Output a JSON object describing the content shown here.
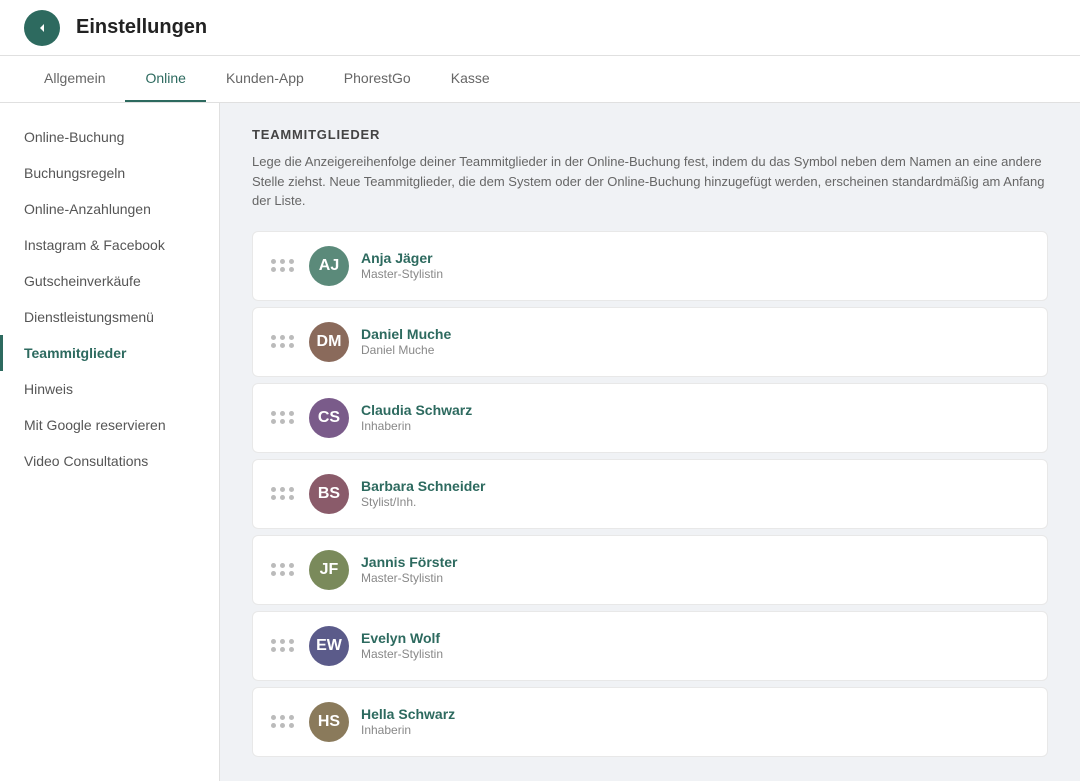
{
  "header": {
    "title": "Einstellungen",
    "back_label": "Back"
  },
  "tabs": [
    {
      "id": "allgemein",
      "label": "Allgemein",
      "active": false
    },
    {
      "id": "online",
      "label": "Online",
      "active": true
    },
    {
      "id": "kunden-app",
      "label": "Kunden-App",
      "active": false
    },
    {
      "id": "phorestgo",
      "label": "PhorestGo",
      "active": false
    },
    {
      "id": "kasse",
      "label": "Kasse",
      "active": false
    }
  ],
  "sidebar": {
    "items": [
      {
        "id": "online-buchung",
        "label": "Online-Buchung",
        "active": false
      },
      {
        "id": "buchungsregeln",
        "label": "Buchungsregeln",
        "active": false
      },
      {
        "id": "online-anzahlungen",
        "label": "Online-Anzahlungen",
        "active": false
      },
      {
        "id": "instagram-facebook",
        "label": "Instagram & Facebook",
        "active": false
      },
      {
        "id": "gutscheinverkaufe",
        "label": "Gutscheinverkäufe",
        "active": false
      },
      {
        "id": "dienstleistungsmenu",
        "label": "Dienstleistungsmenü",
        "active": false
      },
      {
        "id": "teammitglieder",
        "label": "Teammitglieder",
        "active": true
      },
      {
        "id": "hinweis",
        "label": "Hinweis",
        "active": false
      },
      {
        "id": "mit-google-reservieren",
        "label": "Mit Google reservieren",
        "active": false
      },
      {
        "id": "video-consultations",
        "label": "Video Consultations",
        "active": false
      }
    ]
  },
  "main": {
    "section_title": "TEAMMITGLIEDER",
    "section_desc": "Lege die Anzeigereihenfolge deiner Teammitglieder in der Online-Buchung fest, indem du das Symbol neben dem Namen an eine andere Stelle ziehst. Neue Teammitglieder, die dem System oder der Online-Buchung hinzugefügt werden, erscheinen standardmäßig am Anfang der Liste.",
    "team_members": [
      {
        "id": "anja-jager",
        "name": "Anja Jäger",
        "role": "Master-Stylistin",
        "initials": "AJ",
        "av_class": "av-teal"
      },
      {
        "id": "daniel-muche",
        "name": "Daniel Muche",
        "role": "Daniel Muche",
        "initials": "DM",
        "av_class": "av-brown"
      },
      {
        "id": "claudia-schwarz",
        "name": "Claudia Schwarz",
        "role": "Inhaberin",
        "initials": "CS",
        "av_class": "av-purple"
      },
      {
        "id": "barbara-schneider",
        "name": "Barbara Schneider",
        "role": "Stylist/Inh.",
        "initials": "BS",
        "av_class": "av-pink"
      },
      {
        "id": "jannis-forster",
        "name": "Jannis Förster",
        "role": "Master-Stylistin",
        "initials": "JF",
        "av_class": "av-olive"
      },
      {
        "id": "evelyn-wolf",
        "name": "Evelyn Wolf",
        "role": "Master-Stylistin",
        "initials": "EW",
        "av_class": "av-dark"
      },
      {
        "id": "hella-schwarz",
        "name": "Hella Schwarz",
        "role": "Inhaberin",
        "initials": "HS",
        "av_class": "av-orange"
      }
    ]
  }
}
